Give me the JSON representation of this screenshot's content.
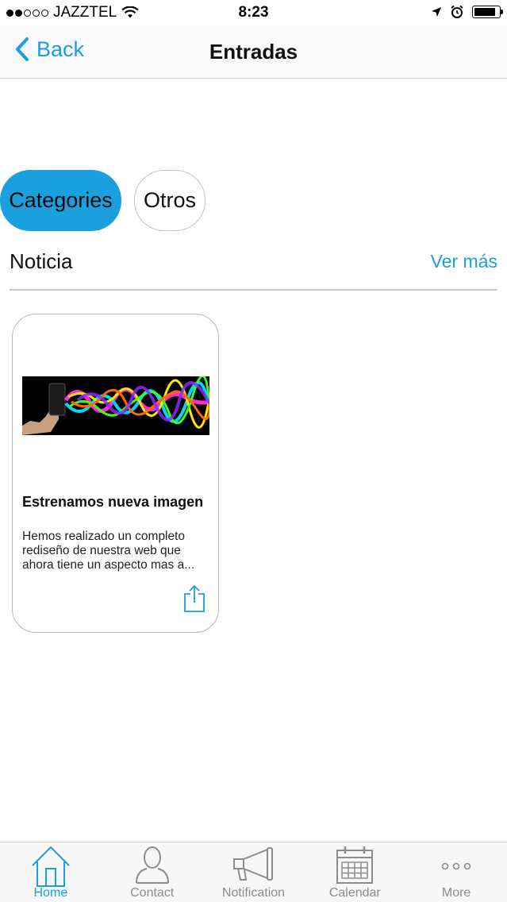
{
  "status_bar": {
    "carrier": "JAZZTEL",
    "time": "8:23",
    "signal_bars_filled": 2,
    "signal_bars_total": 5,
    "battery_level": 0.85
  },
  "nav": {
    "back_label": "Back",
    "title": "Entradas"
  },
  "chips": [
    {
      "label": "Categories",
      "active": true
    },
    {
      "label": "Otros",
      "active": false
    }
  ],
  "section": {
    "title": "Noticia",
    "see_more": "Ver más"
  },
  "card": {
    "title": "Estrenamos nueva imagen",
    "description": "Hemos realizado un completo rediseño de nuestra web que ahora tiene un aspecto mas a..."
  },
  "tabs": [
    {
      "label": "Home",
      "icon": "home-icon",
      "active": true
    },
    {
      "label": "Contact",
      "icon": "person-icon",
      "active": false
    },
    {
      "label": "Notification",
      "icon": "megaphone-icon",
      "active": false
    },
    {
      "label": "Calendar",
      "icon": "calendar-icon",
      "active": false
    },
    {
      "label": "More",
      "icon": "more-dots-icon",
      "active": false
    }
  ],
  "colors": {
    "accent": "#1aa0dd",
    "inactive_tab": "#8c8c8c"
  }
}
